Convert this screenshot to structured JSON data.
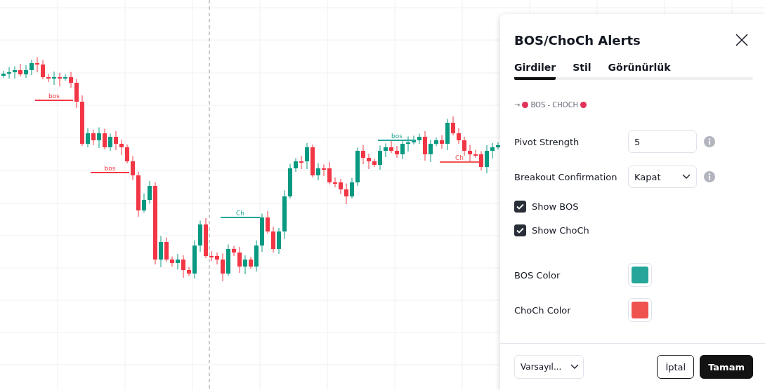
{
  "chart": {
    "markers": [
      {
        "label": "bos",
        "color": "#f23645"
      },
      {
        "label": "bos",
        "color": "#f23645"
      },
      {
        "label": "Ch",
        "color": "#26a69a"
      },
      {
        "label": "bos",
        "color": "#26a69a"
      },
      {
        "label": "Ch",
        "color": "#ef5350"
      }
    ]
  },
  "dialog": {
    "title": "BOS/ChoCh Alerts",
    "tabs": [
      {
        "label": "Girdiler",
        "selected": true
      },
      {
        "label": "Stil",
        "selected": false
      },
      {
        "label": "Görünürlük",
        "selected": false
      }
    ],
    "group_title": {
      "arrow": "→",
      "text": "BOS - CHOCH",
      "color": "#e0325a"
    },
    "inputs": [
      {
        "kind": "number",
        "label": "Pivot Strength",
        "value": "5",
        "info": true
      },
      {
        "kind": "select",
        "label": "Breakout Confirmation",
        "value": "Kapat",
        "info": true
      },
      {
        "kind": "checkbox",
        "label": "Show BOS",
        "checked": true
      },
      {
        "kind": "checkbox",
        "label": "Show ChoCh",
        "checked": true
      },
      {
        "kind": "color",
        "label": "BOS Color",
        "color": "#26a69a"
      },
      {
        "kind": "color",
        "label": "ChoCh Color",
        "color": "#ef5350"
      }
    ],
    "footer": {
      "preset": "Varsayıl...",
      "buttons": [
        {
          "label": "İptal",
          "kind": "secondary"
        },
        {
          "label": "Tamam",
          "kind": "primary"
        }
      ]
    }
  }
}
